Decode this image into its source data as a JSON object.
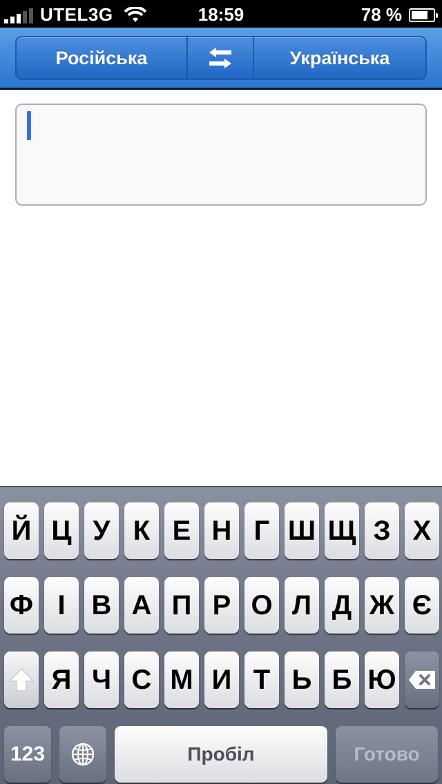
{
  "status": {
    "carrier": "UTEL3G",
    "time": "18:59",
    "battery_percent": "78 %",
    "battery_level": 0.78
  },
  "toolbar": {
    "source_language": "Російська",
    "target_language": "Українська",
    "swap_icon": "swap-arrows-icon"
  },
  "input": {
    "value": ""
  },
  "keyboard": {
    "row1": [
      "Й",
      "Ц",
      "У",
      "К",
      "Е",
      "Н",
      "Г",
      "Ш",
      "Щ",
      "З",
      "Х"
    ],
    "row2": [
      "Ф",
      "І",
      "В",
      "А",
      "П",
      "Р",
      "О",
      "Л",
      "Д",
      "Ж",
      "Є"
    ],
    "row3": [
      "Я",
      "Ч",
      "С",
      "М",
      "И",
      "Т",
      "Ь",
      "Б",
      "Ю"
    ],
    "numbers_label": "123",
    "space_label": "Пробіл",
    "done_label": "Готово",
    "globe_icon": "globe-icon",
    "shift_icon": "shift-icon",
    "backspace_icon": "backspace-icon"
  }
}
